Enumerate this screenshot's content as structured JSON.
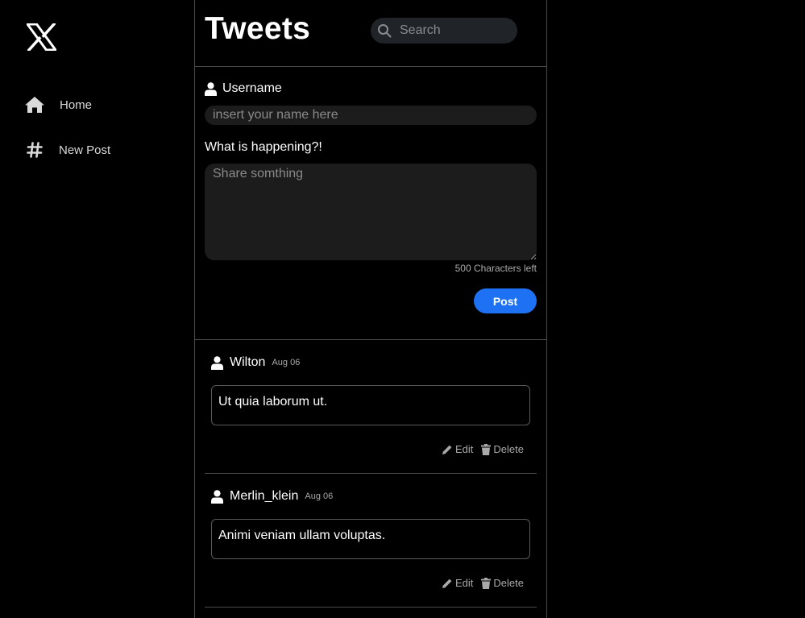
{
  "sidebar": {
    "logo": "x-logo",
    "items": [
      {
        "label": "Home",
        "icon": "home-icon"
      },
      {
        "label": "New Post",
        "icon": "hashtag-icon"
      }
    ]
  },
  "header": {
    "title": "Tweets",
    "search": {
      "placeholder": "Search",
      "value": "",
      "icon": "search-icon"
    }
  },
  "compose": {
    "username_label": "Username",
    "username_placeholder": "insert your name here",
    "username_value": "",
    "prompt_label": "What is happening?!",
    "text_placeholder": "Share somthing",
    "text_value": "",
    "chars_left": "500 Characters left",
    "post_label": "Post"
  },
  "tweets": [
    {
      "username": "Wilton",
      "date": "Aug 06",
      "text": "Ut quia laborum ut.",
      "edit_label": "Edit",
      "delete_label": "Delete"
    },
    {
      "username": "Merlin_klein",
      "date": "Aug 06",
      "text": "Animi veniam ullam voluptas.",
      "edit_label": "Edit",
      "delete_label": "Delete"
    }
  ],
  "colors": {
    "background": "#000000",
    "accent": "#1d71f2",
    "border": "#4a4a4a",
    "input_bg": "#1c1c1c",
    "muted": "#a9a9a9"
  }
}
